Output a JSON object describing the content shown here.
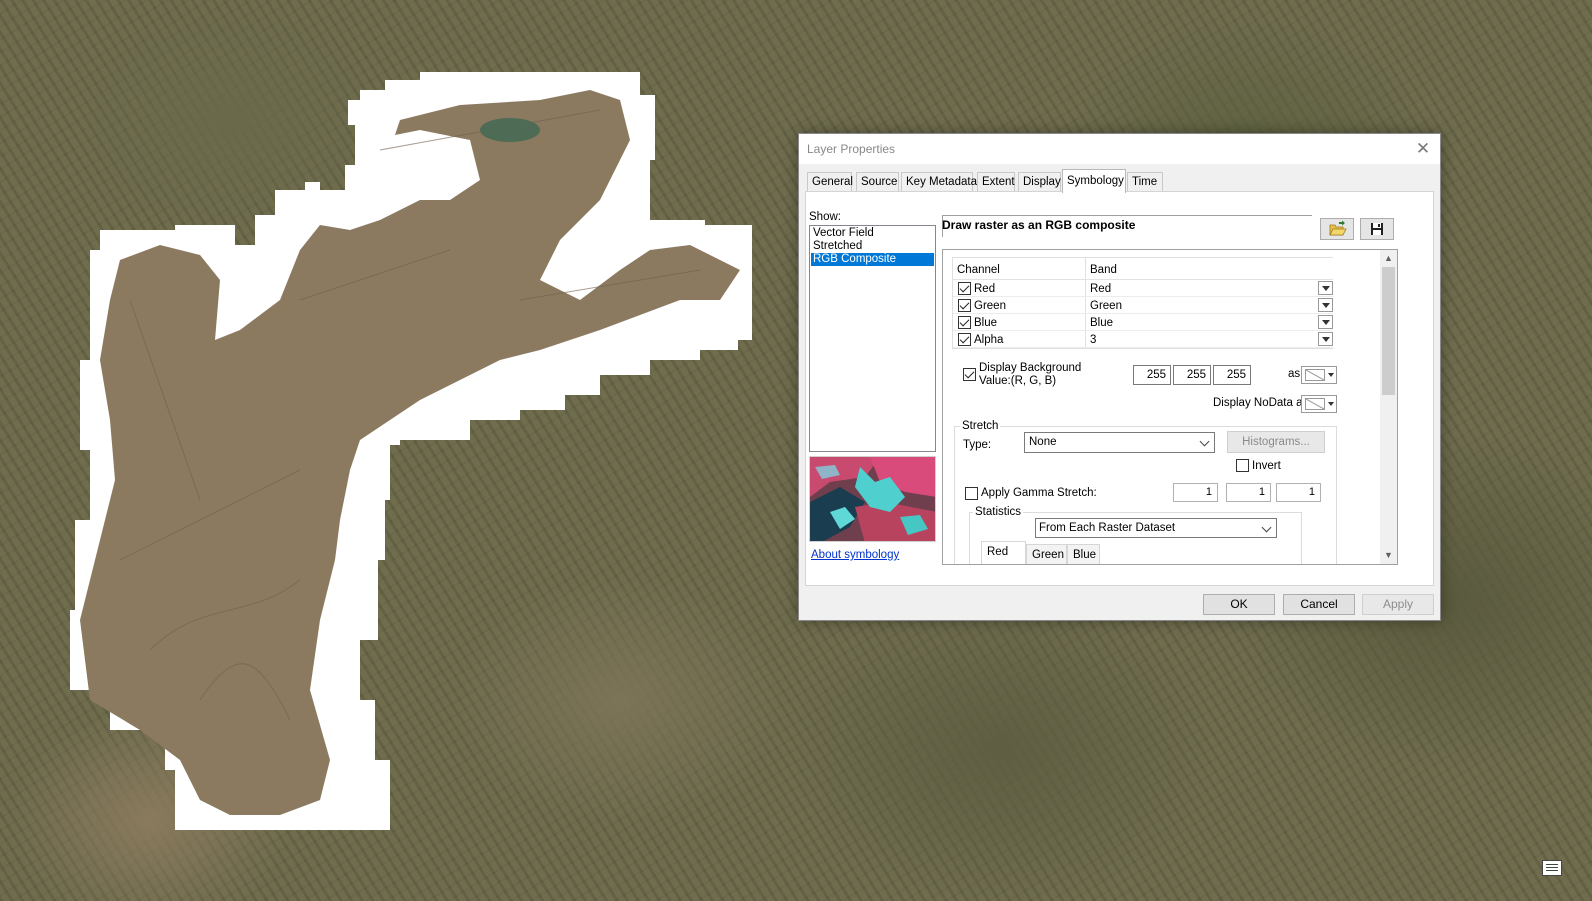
{
  "dialog": {
    "title": "Layer Properties",
    "tabs": [
      "General",
      "Source",
      "Key Metadata",
      "Extent",
      "Display",
      "Symbology",
      "Time"
    ],
    "active_tab": "Symbology",
    "buttons": {
      "ok": "OK",
      "cancel": "Cancel",
      "apply": "Apply"
    }
  },
  "symbology": {
    "show_label": "Show:",
    "show_items": [
      "Vector Field",
      "Stretched",
      "RGB Composite"
    ],
    "selected_show": "RGB Composite",
    "about_link": "About symbology",
    "draw_title": "Draw raster as an RGB composite",
    "channel_table": {
      "headers": [
        "Channel",
        "Band"
      ],
      "rows": [
        {
          "channel": "Red",
          "band": "Red",
          "checked": true
        },
        {
          "channel": "Green",
          "band": "Green",
          "checked": true
        },
        {
          "channel": "Blue",
          "band": "Blue",
          "checked": true
        },
        {
          "channel": "Alpha",
          "band": "3",
          "checked": true
        }
      ]
    },
    "background": {
      "label": "Display Background Value:(R, G, B)",
      "checked": true,
      "r": "255",
      "g": "255",
      "b": "255",
      "as_label": "as"
    },
    "nodata_label": "Display NoData as",
    "stretch": {
      "legend": "Stretch",
      "type_label": "Type:",
      "type_value": "None",
      "histograms_label": "Histograms...",
      "invert_label": "Invert",
      "invert_checked": false,
      "gamma_label": "Apply Gamma Stretch:",
      "gamma_checked": false,
      "gamma_values": [
        "1",
        "1",
        "1"
      ]
    },
    "statistics": {
      "legend": "Statistics",
      "source_value": "From Each Raster Dataset",
      "tabs": [
        "Red",
        "Green",
        "Blue"
      ],
      "active_tab": "Red"
    }
  },
  "icons": [
    "close-icon",
    "open-folder-icon",
    "save-icon",
    "chevron-down-icon",
    "scroll-up-icon",
    "scroll-down-icon",
    "notification-icon"
  ],
  "colors": {
    "selection": "#0078d7",
    "link": "#0033cc",
    "clip_mask": "#ffffff"
  }
}
